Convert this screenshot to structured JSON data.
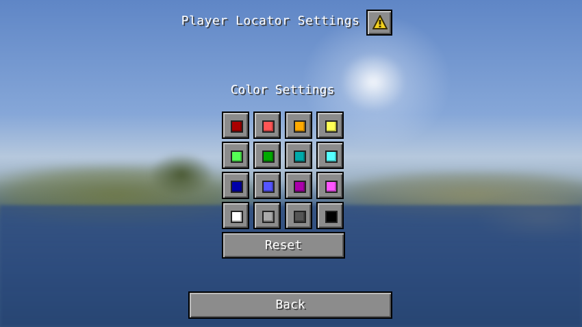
{
  "screen": {
    "title": "Player Locator Settings",
    "warning_icon": "warning-triangle-icon"
  },
  "color_settings": {
    "label": "Color Settings",
    "swatches": [
      {
        "name": "dark-red",
        "color": "#aa0000"
      },
      {
        "name": "red",
        "color": "#ff5555"
      },
      {
        "name": "gold",
        "color": "#ffaa00"
      },
      {
        "name": "yellow",
        "color": "#ffff55"
      },
      {
        "name": "green",
        "color": "#55ff55"
      },
      {
        "name": "dark-green",
        "color": "#00aa00"
      },
      {
        "name": "dark-aqua",
        "color": "#00aaaa"
      },
      {
        "name": "aqua",
        "color": "#55ffff"
      },
      {
        "name": "dark-blue",
        "color": "#0000aa"
      },
      {
        "name": "blue",
        "color": "#5555ff"
      },
      {
        "name": "dark-purple",
        "color": "#aa00aa"
      },
      {
        "name": "light-purple",
        "color": "#ff55ff"
      },
      {
        "name": "white",
        "color": "#ffffff"
      },
      {
        "name": "gray",
        "color": "#aaaaaa"
      },
      {
        "name": "dark-gray",
        "color": "#555555"
      },
      {
        "name": "black",
        "color": "#000000"
      }
    ],
    "reset_label": "Reset"
  },
  "footer": {
    "back_label": "Back"
  }
}
